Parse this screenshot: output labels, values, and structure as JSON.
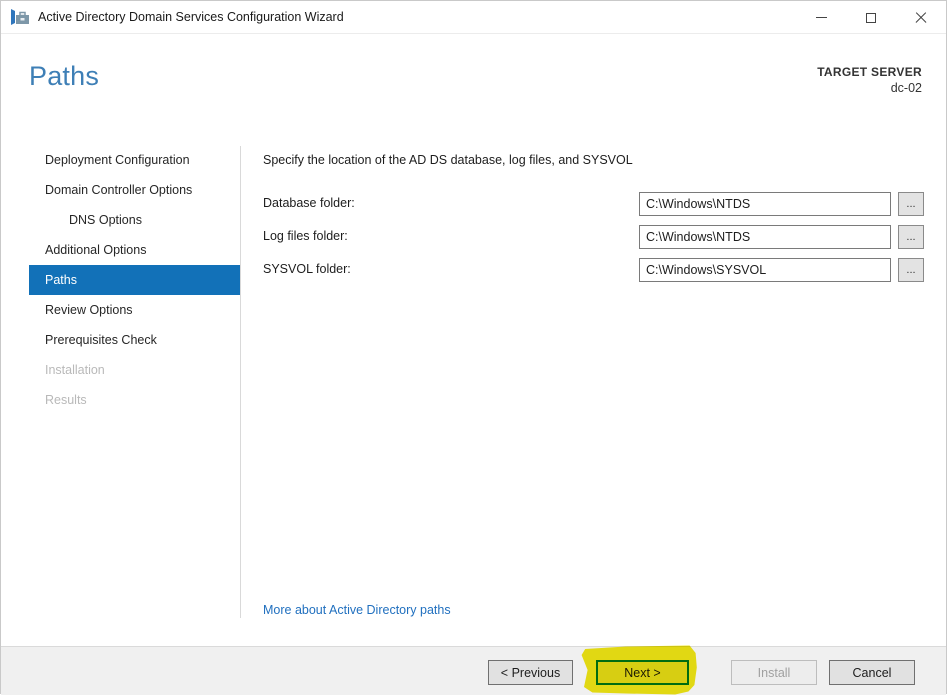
{
  "window": {
    "title": "Active Directory Domain Services Configuration Wizard"
  },
  "header": {
    "page_title": "Paths",
    "target_server_label": "TARGET SERVER",
    "target_server_name": "dc-02"
  },
  "sidebar": {
    "items": [
      {
        "label": "Deployment Configuration",
        "state": "normal"
      },
      {
        "label": "Domain Controller Options",
        "state": "normal"
      },
      {
        "label": "DNS Options",
        "state": "indented"
      },
      {
        "label": "Additional Options",
        "state": "normal"
      },
      {
        "label": "Paths",
        "state": "selected"
      },
      {
        "label": "Review Options",
        "state": "normal"
      },
      {
        "label": "Prerequisites Check",
        "state": "normal"
      },
      {
        "label": "Installation",
        "state": "disabled"
      },
      {
        "label": "Results",
        "state": "disabled"
      }
    ]
  },
  "main": {
    "instruction": "Specify the location of the AD DS database, log files, and SYSVOL",
    "fields": [
      {
        "label": "Database folder:",
        "value": "C:\\Windows\\NTDS"
      },
      {
        "label": "Log files folder:",
        "value": "C:\\Windows\\NTDS"
      },
      {
        "label": "SYSVOL folder:",
        "value": "C:\\Windows\\SYSVOL"
      }
    ],
    "browse_label": "...",
    "more_link": "More about Active Directory paths"
  },
  "footer": {
    "previous_label": "< Previous",
    "next_label": "Next >",
    "install_label": "Install",
    "cancel_label": "Cancel"
  },
  "annotations": {
    "highlighted_button": "Next >",
    "highlight_color": "#efe400"
  },
  "colors": {
    "accent_selected": "#1271b8",
    "heading": "#3e7fb6",
    "link": "#2170bf",
    "default_button_border": "#0078d7"
  }
}
